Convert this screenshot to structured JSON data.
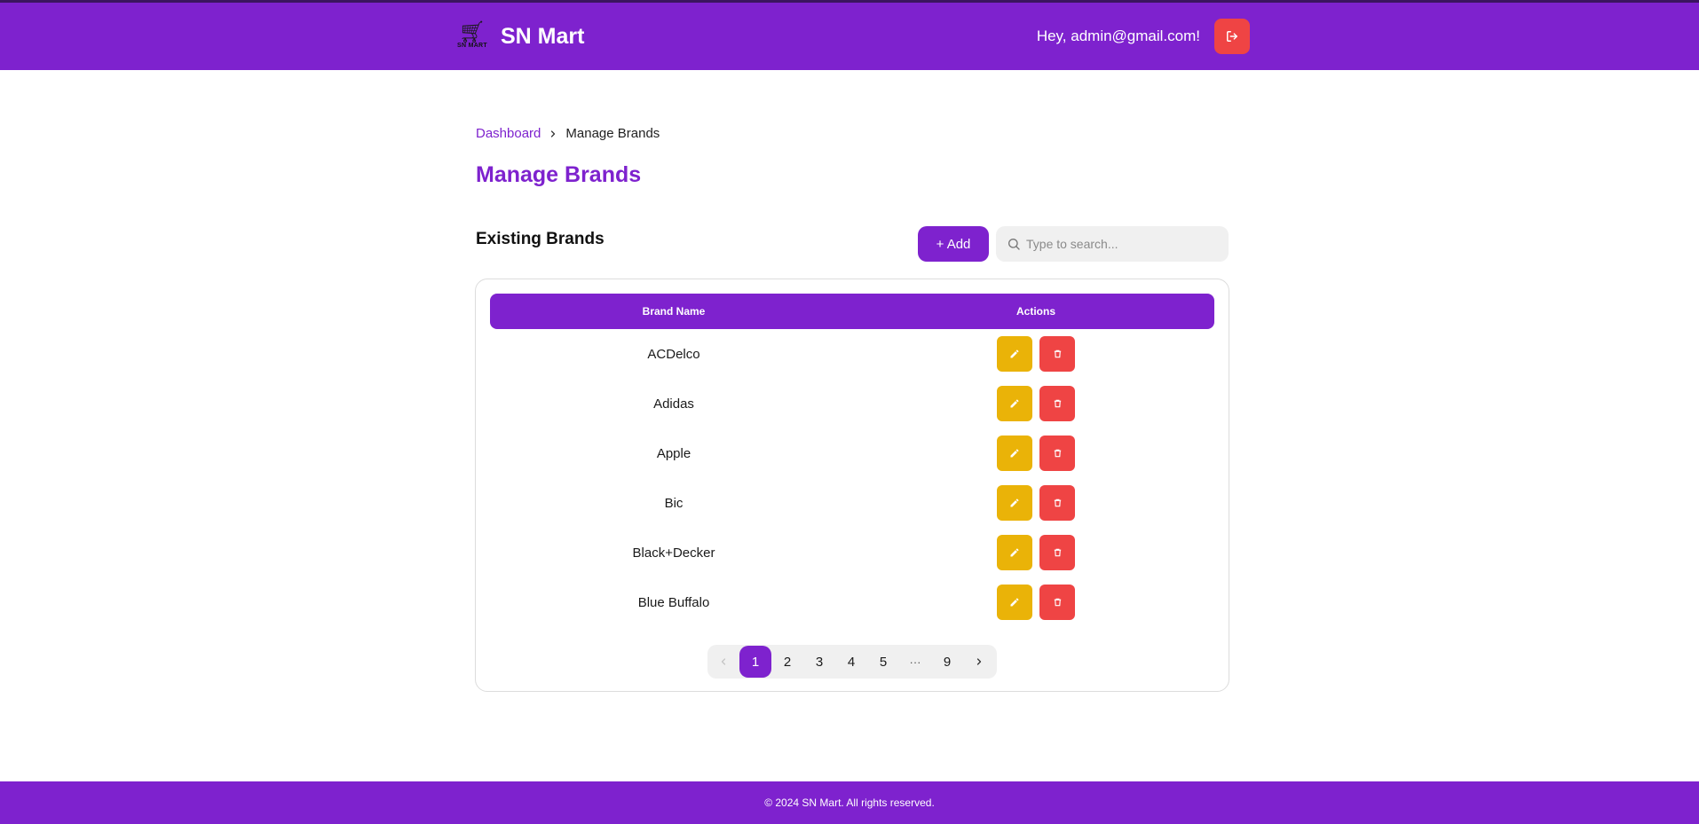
{
  "header": {
    "app_name": "SN Mart",
    "logo_caption": "SN MART",
    "greeting": "Hey, admin@gmail.com!",
    "logout_icon": "logout-icon"
  },
  "breadcrumb": {
    "link": "Dashboard",
    "separator_icon": "chevron-right-icon",
    "current": "Manage Brands"
  },
  "page": {
    "title": "Manage Brands",
    "section_title": "Existing Brands",
    "add_label": "+ Add",
    "search_placeholder": "Type to search..."
  },
  "table": {
    "columns": [
      "Brand Name",
      "Actions"
    ],
    "rows": [
      {
        "name": "ACDelco"
      },
      {
        "name": "Adidas"
      },
      {
        "name": "Apple"
      },
      {
        "name": "Bic"
      },
      {
        "name": "Black+Decker"
      },
      {
        "name": "Blue Buffalo"
      }
    ]
  },
  "pagination": {
    "prev": "‹",
    "pages": [
      "1",
      "2",
      "3",
      "4",
      "5",
      "···",
      "9"
    ],
    "active": "1",
    "next": "›"
  },
  "footer": {
    "text": "© 2024 SN Mart. All rights reserved."
  },
  "colors": {
    "brand": "#7e22ce",
    "edit": "#eab308",
    "danger": "#ef4444"
  }
}
